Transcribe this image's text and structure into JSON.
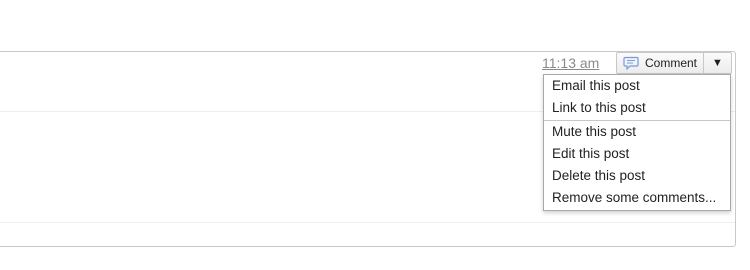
{
  "post": {
    "timestamp": "11:13 am",
    "comment_label": "Comment",
    "menu_toggle": "▼"
  },
  "menu": {
    "group1": [
      "Email this post",
      "Link to this post"
    ],
    "group2": [
      "Mute this post",
      "Edit this post",
      "Delete this post",
      "Remove some comments..."
    ]
  },
  "icons": {
    "comment": "comment-bubble-icon",
    "toggle": "dropdown-arrow-icon"
  },
  "colors": {
    "comment_icon": "#7a9ad6",
    "timestamp": "#8a8a8a"
  }
}
